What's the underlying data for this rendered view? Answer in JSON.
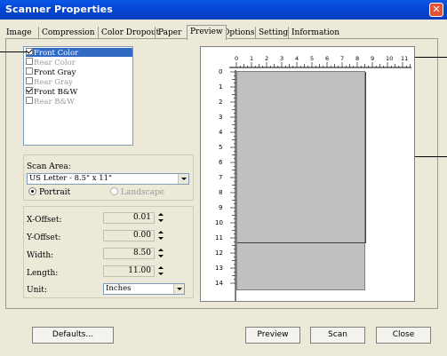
{
  "window": {
    "title": "Scanner Properties",
    "close_label": "✕"
  },
  "tabs": [
    {
      "label": "Image"
    },
    {
      "label": "Compression"
    },
    {
      "label": "Color Dropout"
    },
    {
      "label": "Paper"
    },
    {
      "label": "Preview",
      "active": true
    },
    {
      "label": "Options"
    },
    {
      "label": "Setting"
    },
    {
      "label": "Information"
    }
  ],
  "image_list": [
    {
      "label": "Front Color",
      "checked": true,
      "selected": true,
      "enabled": true
    },
    {
      "label": "Rear Color",
      "checked": false,
      "selected": false,
      "enabled": false
    },
    {
      "label": "Front Gray",
      "checked": false,
      "selected": false,
      "enabled": true
    },
    {
      "label": "Rear Gray",
      "checked": false,
      "selected": false,
      "enabled": false
    },
    {
      "label": "Front B&W",
      "checked": true,
      "selected": false,
      "enabled": true
    },
    {
      "label": "Rear B&W",
      "checked": false,
      "selected": false,
      "enabled": false
    }
  ],
  "scan_area": {
    "label": "Scan Area:",
    "value": "US Letter - 8.5\" x 11\"",
    "portrait_label": "Portrait",
    "landscape_label": "Landscape",
    "orientation": "Portrait"
  },
  "dimensions": {
    "x_offset": {
      "label": "X-Offset:",
      "value": "0.01"
    },
    "y_offset": {
      "label": "Y-Offset:",
      "value": "0.00"
    },
    "width": {
      "label": "Width:",
      "value": "8.50"
    },
    "length": {
      "label": "Length:",
      "value": "11.00"
    },
    "unit": {
      "label": "Unit:",
      "value": "Inches"
    }
  },
  "ruler": {
    "h_labels": [
      "0",
      "1",
      "2",
      "3",
      "4",
      "5",
      "6",
      "7",
      "8",
      "9",
      "10",
      "11"
    ],
    "v_labels": [
      "0",
      "1",
      "2",
      "3",
      "4",
      "5",
      "6",
      "7",
      "8",
      "9",
      "10",
      "11",
      "12",
      "13",
      "14"
    ]
  },
  "buttons": {
    "defaults": "Defaults...",
    "preview": "Preview",
    "scan": "Scan",
    "close": "Close"
  },
  "colors": {
    "titlebar": "#0a58e6",
    "selection": "#316ac5",
    "close": "#e2533a"
  }
}
